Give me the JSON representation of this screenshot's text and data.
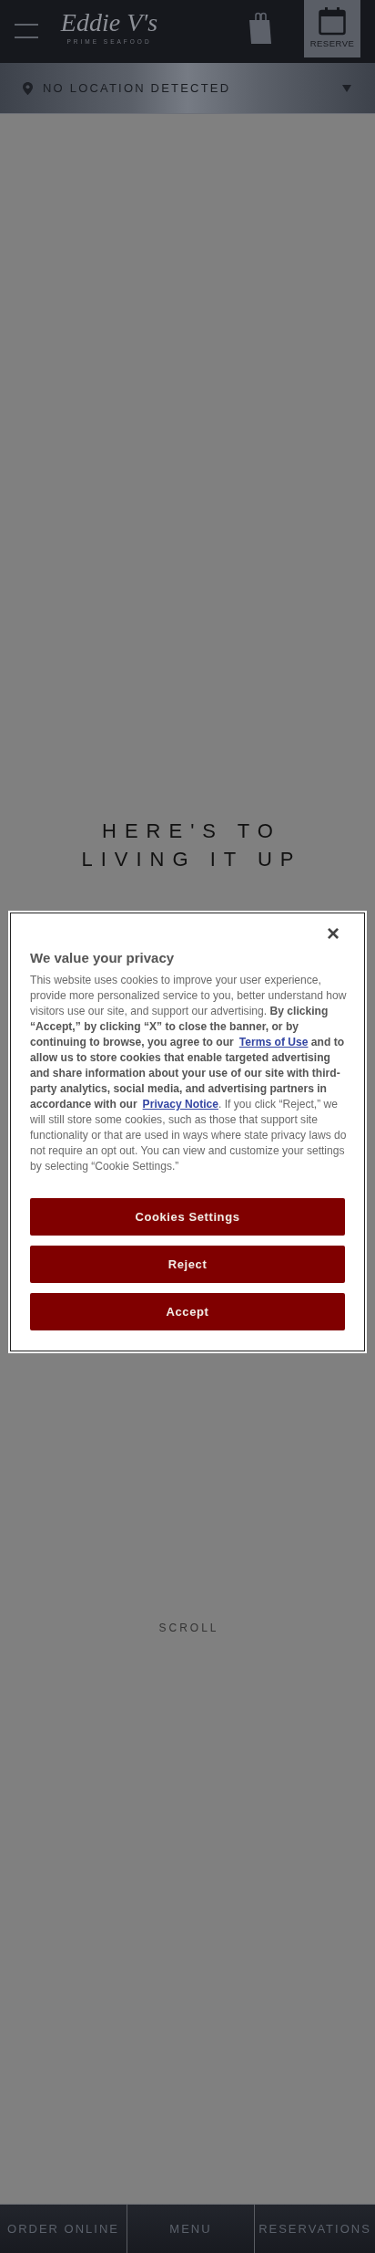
{
  "header": {
    "logo": {
      "name": "Eddie V's",
      "tagline": "PRIME SEAFOOD"
    },
    "reserve_label": "RESERVE"
  },
  "location_bar": {
    "label": "NO LOCATION DETECTED"
  },
  "hero": {
    "headline_lines": [
      "HERE'S TO",
      "LIVING IT UP"
    ],
    "scroll_label": "SCROLL"
  },
  "cookie_banner": {
    "title": "We value your privacy",
    "close_label": "×",
    "body": [
      {
        "kind": "text",
        "text": "This website uses cookies to improve your user experience, provide more personalized service to you, better understand how visitors use our site, and support our advertising. **By clicking “Accept,” by clicking “X” to close the banner, or by continuing to browse, you agree to our**"
      },
      {
        "kind": "link",
        "text": "Terms of Use"
      },
      {
        "kind": "text",
        "text": "**and to allow us to store cookies that enable targeted advertising and share information about your use of our site with third-party analytics, social media, and advertising partners in accordance with our**"
      },
      {
        "kind": "link",
        "text": "Privacy Notice"
      },
      {
        "kind": "text",
        "text": ". If you click “Reject,” we will still store some cookies, such as those that support site functionality or that are used in ways where state privacy laws do not require an opt out. You can view and customize your settings by selecting “Cookie Settings.”"
      }
    ],
    "buttons": [
      "Cookies Settings",
      "Reject",
      "Accept"
    ]
  },
  "bottom_nav": [
    "ORDER ONLINE",
    "MENU",
    "RESERVATIONS"
  ]
}
